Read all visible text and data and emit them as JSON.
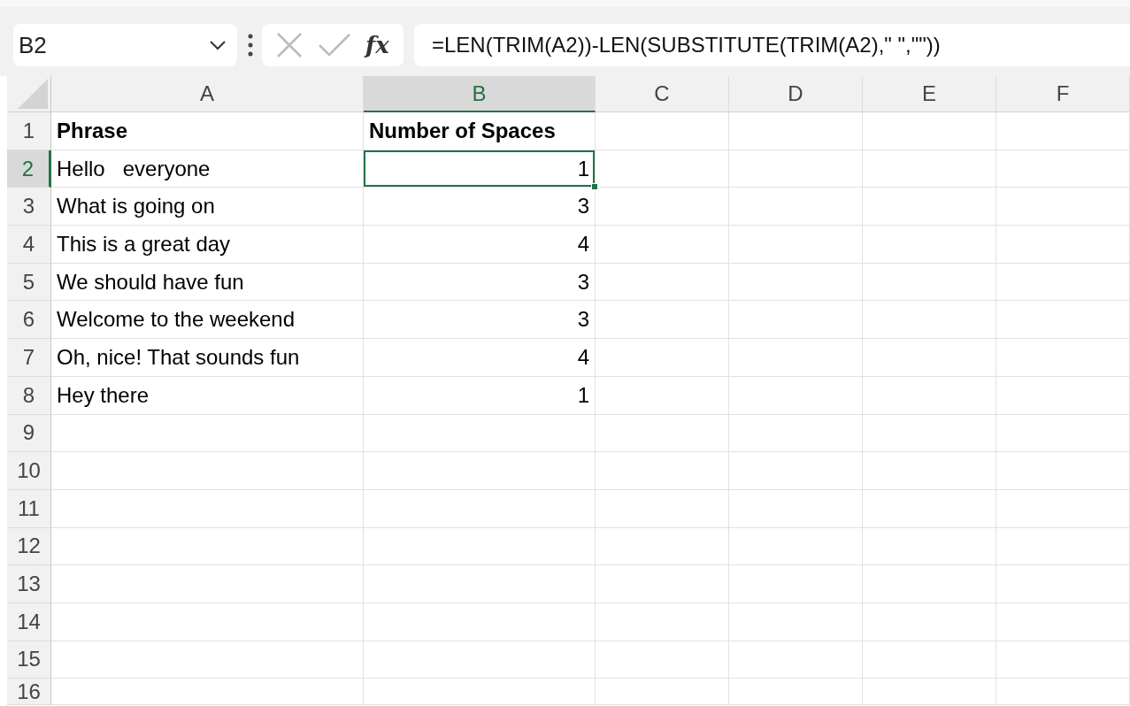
{
  "formula_bar": {
    "name_box": "B2",
    "function_label": "fx",
    "formula": "=LEN(TRIM(A2))-LEN(SUBSTITUTE(TRIM(A2),\" \",\"\"))"
  },
  "columns": [
    {
      "label": "A",
      "selected": false
    },
    {
      "label": "B",
      "selected": true
    },
    {
      "label": "C",
      "selected": false
    },
    {
      "label": "D",
      "selected": false
    },
    {
      "label": "E",
      "selected": false
    },
    {
      "label": "F",
      "selected": false
    }
  ],
  "rows": [
    {
      "label": "1",
      "selected": false,
      "kind": "header",
      "cells": [
        {
          "text": "Phrase",
          "kind": "text",
          "active": false
        },
        {
          "text": "Number of Spaces",
          "kind": "text",
          "active": false
        }
      ]
    },
    {
      "label": "2",
      "selected": true,
      "kind": "data",
      "cells": [
        {
          "text": "Hello   everyone",
          "kind": "text",
          "active": false
        },
        {
          "text": "1",
          "kind": "number",
          "active": true
        }
      ]
    },
    {
      "label": "3",
      "selected": false,
      "kind": "data",
      "cells": [
        {
          "text": "What is going on",
          "kind": "text",
          "active": false
        },
        {
          "text": "3",
          "kind": "number",
          "active": false
        }
      ]
    },
    {
      "label": "4",
      "selected": false,
      "kind": "data",
      "cells": [
        {
          "text": "This is a great day",
          "kind": "text",
          "active": false
        },
        {
          "text": "4",
          "kind": "number",
          "active": false
        }
      ]
    },
    {
      "label": "5",
      "selected": false,
      "kind": "data",
      "cells": [
        {
          "text": "We should have fun",
          "kind": "text",
          "active": false
        },
        {
          "text": "3",
          "kind": "number",
          "active": false
        }
      ]
    },
    {
      "label": "6",
      "selected": false,
      "kind": "data",
      "cells": [
        {
          "text": "Welcome to the weekend",
          "kind": "text",
          "active": false
        },
        {
          "text": "3",
          "kind": "number",
          "active": false
        }
      ]
    },
    {
      "label": "7",
      "selected": false,
      "kind": "data",
      "cells": [
        {
          "text": "Oh, nice! That sounds fun",
          "kind": "text",
          "active": false
        },
        {
          "text": "4",
          "kind": "number",
          "active": false
        }
      ]
    },
    {
      "label": "8",
      "selected": false,
      "kind": "data",
      "cells": [
        {
          "text": "Hey there",
          "kind": "text",
          "active": false
        },
        {
          "text": "1",
          "kind": "number",
          "active": false
        }
      ]
    },
    {
      "label": "9",
      "selected": false
    },
    {
      "label": "10",
      "selected": false
    },
    {
      "label": "11",
      "selected": false
    },
    {
      "label": "12",
      "selected": false
    },
    {
      "label": "13",
      "selected": false
    },
    {
      "label": "14",
      "selected": false
    },
    {
      "label": "15",
      "selected": false
    },
    {
      "label": "16",
      "selected": false
    }
  ]
}
